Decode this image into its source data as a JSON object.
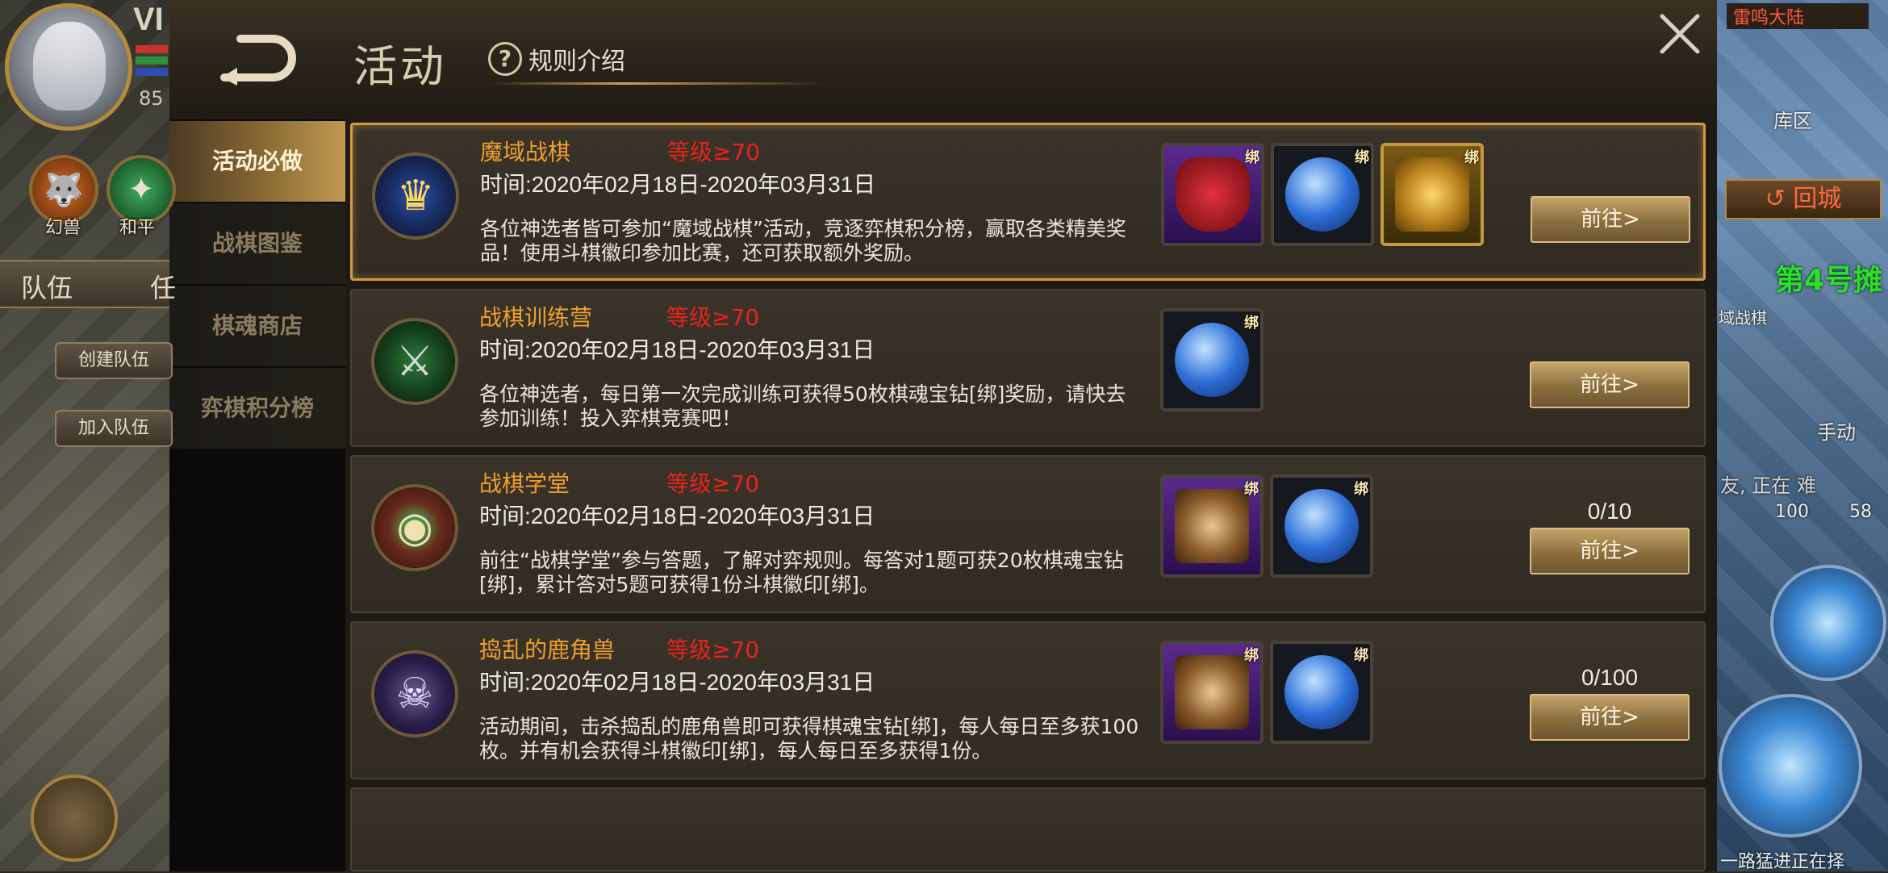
{
  "hud": {
    "vip_text": "VI",
    "level": "85",
    "skills": [
      {
        "label": "幻兽"
      },
      {
        "label": "和平"
      }
    ],
    "team_tabs": [
      "队伍",
      "任"
    ],
    "create_team": "创建队伍",
    "join_team": "加入队伍"
  },
  "right_scene": {
    "map_name": "雷鸣大陆",
    "warehouse": "库区",
    "return_label": "回城",
    "stall_label": "第4号摊",
    "chess_label": "域战棋",
    "auto_label": "手动",
    "chat_snippet": "友, 正在 难",
    "item_count_1": "100",
    "item_count_2": "58",
    "bottom_text": "一路猛进正在择"
  },
  "dialog": {
    "title": "活动",
    "rules_label": "规则介绍",
    "sidebar": [
      {
        "label": "活动必做",
        "active": true
      },
      {
        "label": "战棋图鉴",
        "active": false
      },
      {
        "label": "棋魂商店",
        "active": false
      },
      {
        "label": "弈棋积分榜",
        "active": false
      }
    ],
    "bind_label": "绑",
    "goto_label": "前往>",
    "activities": [
      {
        "name": "魔域战棋",
        "level": "等级≥70",
        "time": "时间:2020年02月18日-2020年03月31日",
        "desc": "各位神选者皆可参加“魔域战棋”活动，竞逐弈棋积分榜，赢取各类精美奖品！使用斗棋徽印参加比赛，还可获取额外奖励。",
        "progress": "",
        "emblem_icon": "crest-icon",
        "rewards": [
          "red-cape-icon",
          "blue-gem-icon",
          "gold-chest-icon"
        ]
      },
      {
        "name": "战棋训练营",
        "level": "等级≥70",
        "time": "时间:2020年02月18日-2020年03月31日",
        "desc": "各位神选者，每日第一次完成训练可获得50枚棋魂宝钻[绑]奖励，请快去参加训练！投入弈棋竞赛吧！",
        "progress": "",
        "emblem_icon": "knight-helmet-icon",
        "rewards": [
          "blue-gem-icon"
        ]
      },
      {
        "name": "战棋学堂",
        "level": "等级≥70",
        "time": "时间:2020年02月18日-2020年03月31日",
        "desc": "前往“战棋学堂”参与答题，了解对弈规则。每答对1题可获20枚棋魂宝钻[绑]，累计答对5题可获得1份斗棋徽印[绑]。",
        "progress": "0/10",
        "emblem_icon": "book-orb-icon",
        "rewards": [
          "cross-badge-icon",
          "blue-gem-icon"
        ]
      },
      {
        "name": "捣乱的鹿角兽",
        "level": "等级≥70",
        "time": "时间:2020年02月18日-2020年03月31日",
        "desc": "活动期间，击杀捣乱的鹿角兽即可获得棋魂宝钻[绑]，每人每日至多获100枚。并有机会获得斗棋徽印[绑]，每人每日至多获得1份。",
        "progress": "0/100",
        "emblem_icon": "antler-beast-icon",
        "rewards": [
          "cross-badge-icon",
          "blue-gem-icon"
        ]
      }
    ]
  },
  "colors": {
    "accent_gold": "#d29b40",
    "activity_name": "#f0a02c",
    "level_red": "#e8231a",
    "stall_green": "#2ae12a"
  }
}
